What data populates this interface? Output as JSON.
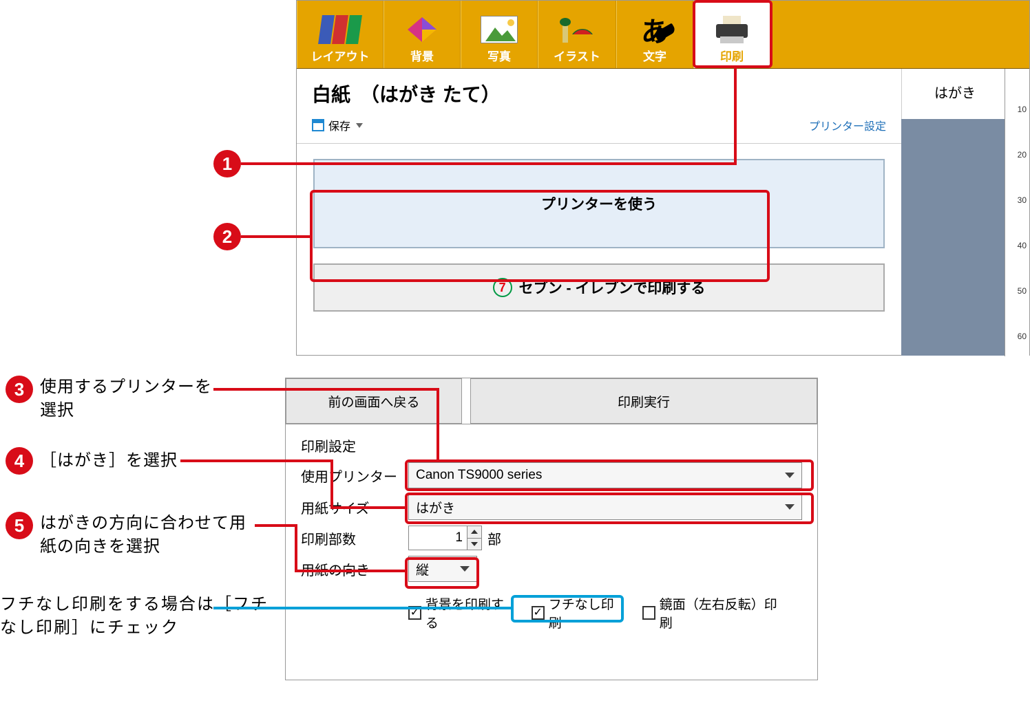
{
  "callouts": {
    "c1": "1",
    "c2": "2",
    "c3_num": "3",
    "c3_text": "使用するプリンターを選択",
    "c4_num": "4",
    "c4_text": "［はがき］を選択",
    "c5_num": "5",
    "c5_text": "はがきの方向に合わせて用紙の向きを選択",
    "borderless_text": "フチなし印刷をする場合は［フチなし印刷］にチェック"
  },
  "toolbar": {
    "layout": "レイアウト",
    "background": "背景",
    "photo": "写真",
    "illust": "イラスト",
    "text": "文字",
    "print": "印刷"
  },
  "header": {
    "title": "白紙　（はがき たて）",
    "save": "保存",
    "printer_settings": "プリンター設定",
    "side_title": "はがき"
  },
  "buttons": {
    "use_printer": "プリンターを使う",
    "seven": "セブン ‐ イレブンで印刷する"
  },
  "ruler": [
    "10",
    "20",
    "30",
    "40",
    "50",
    "60"
  ],
  "panel2": {
    "back": "前の画面へ戻る",
    "execute": "印刷実行",
    "settings_title": "印刷設定",
    "printer_label": "使用プリンター",
    "printer_value": "Canon TS9000 series",
    "size_label": "用紙サイズ",
    "size_value": "はがき",
    "copies_label": "印刷部数",
    "copies_value": "1",
    "copies_unit": "部",
    "orient_label": "用紙の向き",
    "orient_value": "縦",
    "chk_bg": "背景を印刷する",
    "chk_borderless": "フチなし印刷",
    "chk_mirror": "鏡面（左右反転）印刷"
  }
}
